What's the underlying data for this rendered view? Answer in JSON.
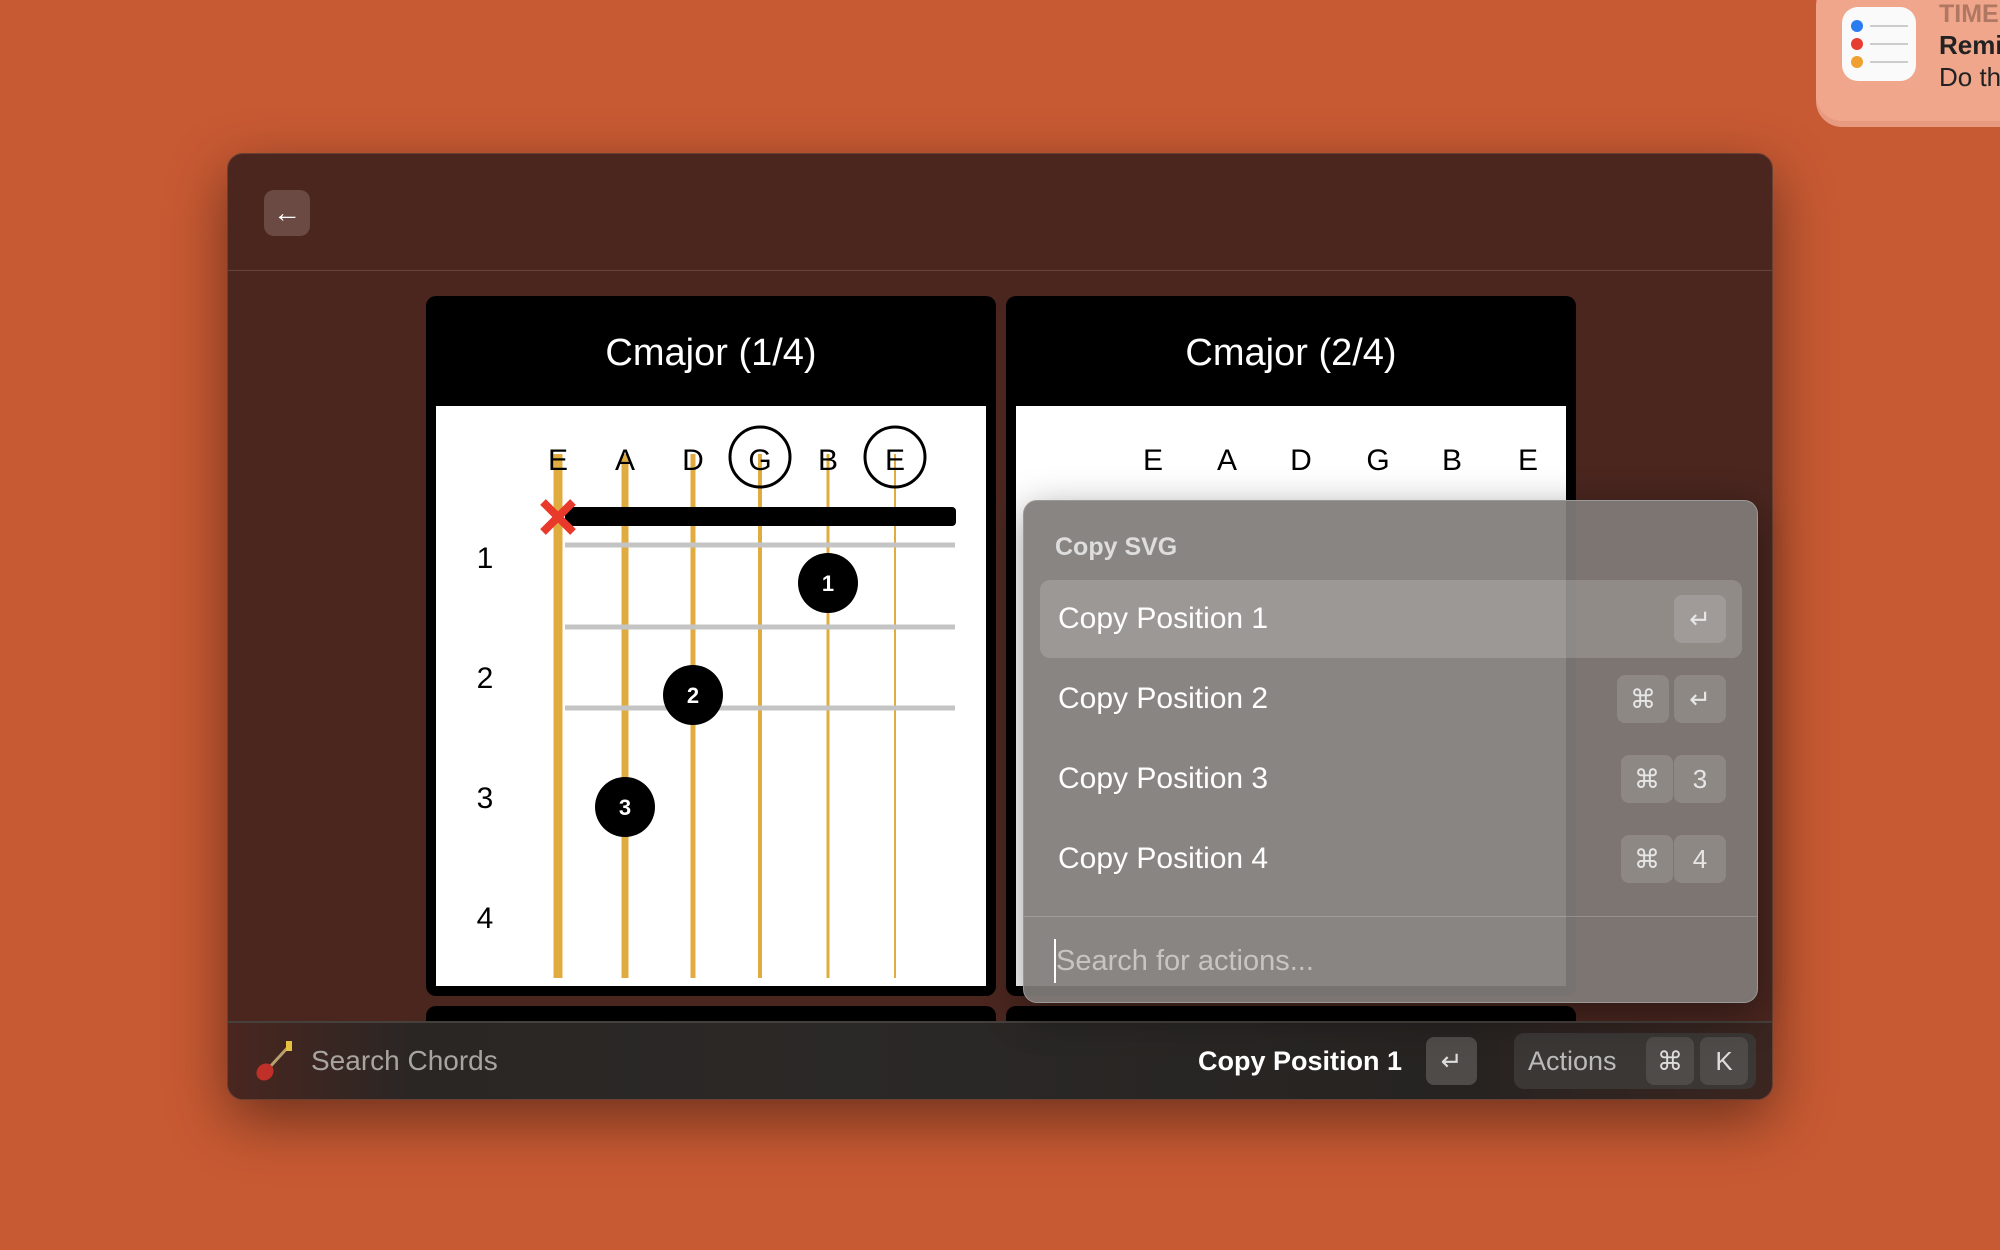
{
  "notification": {
    "app_label": "TIME",
    "title": "Remi",
    "body": "Do th"
  },
  "window": {
    "back_icon": "←"
  },
  "cards": [
    {
      "title": "Cmajor (1/4)",
      "strings": [
        "E",
        "A",
        "D",
        "G",
        "B",
        "E"
      ],
      "open_strings": [
        3,
        5
      ],
      "muted_strings": [
        0
      ],
      "fret_numbers": [
        "1",
        "2",
        "3",
        "4"
      ],
      "fingers": [
        {
          "string": 4,
          "fret": 1,
          "label": "1"
        },
        {
          "string": 2,
          "fret": 2,
          "label": "2"
        },
        {
          "string": 1,
          "fret": 3,
          "label": "3"
        }
      ]
    },
    {
      "title": "Cmajor (2/4)",
      "strings": [
        "E",
        "A",
        "D",
        "G",
        "B",
        "E"
      ]
    }
  ],
  "actions_menu": {
    "section": "Copy SVG",
    "items": [
      {
        "label": "Copy Position 1",
        "keys": [
          "↵"
        ]
      },
      {
        "label": "Copy Position 2",
        "keys": [
          "⌘",
          "↵"
        ]
      },
      {
        "label": "Copy Position 3",
        "keys": [
          "⌘",
          "3"
        ]
      },
      {
        "label": "Copy Position 4",
        "keys": [
          "⌘",
          "4"
        ]
      }
    ],
    "search_placeholder": "Search for actions..."
  },
  "footer": {
    "search_label": "Search Chords",
    "primary_action": "Copy Position 1",
    "primary_key": "↵",
    "actions_label": "Actions",
    "actions_keys": [
      "⌘",
      "K"
    ]
  },
  "colors": {
    "string": "#e0ab3f",
    "mute": "#e8392a",
    "background": "#c85a33"
  }
}
